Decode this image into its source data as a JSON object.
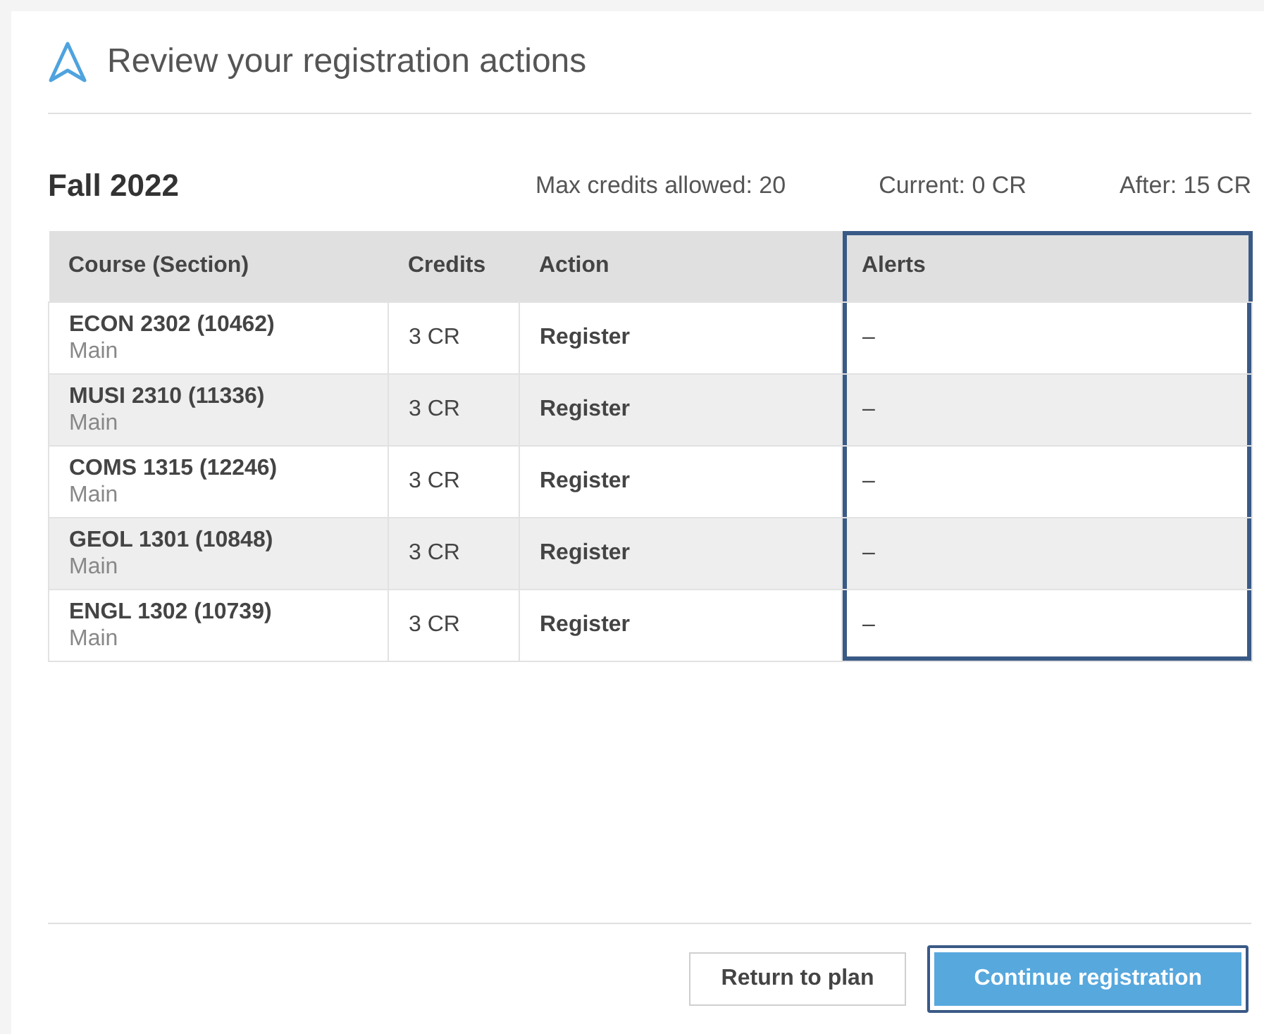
{
  "dialog": {
    "title": "Review your registration actions"
  },
  "term": {
    "name": "Fall 2022",
    "max_credits": "Max credits allowed: 20",
    "current": "Current: 0 CR",
    "after": "After: 15 CR"
  },
  "table": {
    "columns": [
      {
        "label": "Course (Section)",
        "highlighted": false
      },
      {
        "label": "Credits",
        "highlighted": false
      },
      {
        "label": "Action",
        "highlighted": false
      },
      {
        "label": "Alerts",
        "highlighted": true
      }
    ],
    "rows": [
      {
        "course": "ECON 2302 (10462)",
        "campus": "Main",
        "credits": "3 CR",
        "action": "Register",
        "alerts": "–"
      },
      {
        "course": "MUSI 2310 (11336)",
        "campus": "Main",
        "credits": "3 CR",
        "action": "Register",
        "alerts": "–"
      },
      {
        "course": "COMS 1315 (12246)",
        "campus": "Main",
        "credits": "3 CR",
        "action": "Register",
        "alerts": "–"
      },
      {
        "course": "GEOL 1301 (10848)",
        "campus": "Main",
        "credits": "3 CR",
        "action": "Register",
        "alerts": "–"
      },
      {
        "course": "ENGL 1302 (10739)",
        "campus": "Main",
        "credits": "3 CR",
        "action": "Register",
        "alerts": "–"
      }
    ]
  },
  "buttons": [
    {
      "label": "Return to plan",
      "kind": "secondary",
      "highlighted": false
    },
    {
      "label": "Continue registration",
      "kind": "primary",
      "highlighted": true
    }
  ]
}
